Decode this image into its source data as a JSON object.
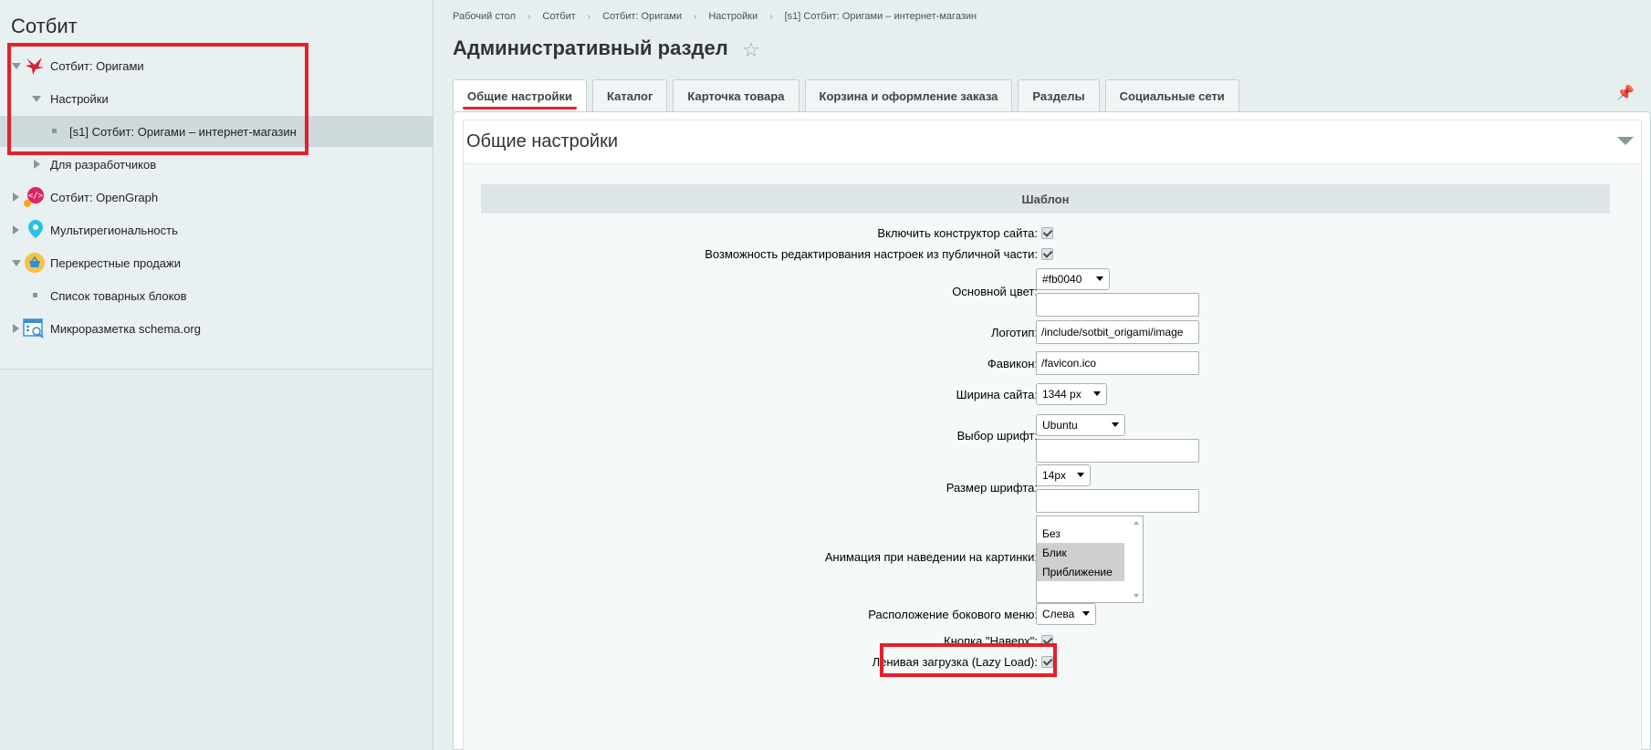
{
  "sidebar": {
    "title": "Сотбит",
    "items": [
      {
        "label": "Сотбит: Оригами",
        "icon": "origami-crane-icon"
      },
      {
        "label": "Настройки"
      },
      {
        "label": "[s1] Сотбит: Оригами – интернет-магазин"
      },
      {
        "label": "Для разработчиков"
      },
      {
        "label": "Сотбит: OpenGraph",
        "icon": "opengraph-icon"
      },
      {
        "label": "Мультирегиональность",
        "icon": "location-pin-icon"
      },
      {
        "label": "Перекрестные продажи",
        "icon": "basket-icon"
      },
      {
        "label": "Список товарных блоков"
      },
      {
        "label": "Микроразметка schema.org",
        "icon": "schema-org-icon"
      }
    ]
  },
  "breadcrumb": [
    "Рабочий стол",
    "Сотбит",
    "Сотбит: Оригами",
    "Настройки",
    "[s1] Сотбит: Оригами – интернет-магазин"
  ],
  "page_title": "Административный раздел",
  "tabs": [
    "Общие настройки",
    "Каталог",
    "Карточка товара",
    "Корзина и оформление заказа",
    "Разделы",
    "Социальные сети"
  ],
  "panel": {
    "title": "Общие настройки",
    "section": "Шаблон",
    "fields": {
      "site_builder": "Включить конструктор сайта:",
      "public_edit": "Возможность редактирования настроек из публичной части:",
      "main_color": "Основной цвет:",
      "main_color_value": "#fb0040",
      "logo": "Логотип:",
      "logo_value": "/include/sotbit_origami/image",
      "favicon": "Фавикон:",
      "favicon_value": "/favicon.ico",
      "site_width": "Ширина сайта:",
      "site_width_value": "1344 px",
      "font_choice": "Выбор шрифт:",
      "font_choice_value": "Ubuntu",
      "font_size": "Размер шрифта:",
      "font_size_value": "14px",
      "hover_animation": "Анимация при наведении на картинки:",
      "hover_animation_options": [
        "Без",
        "Блик",
        "Приближение"
      ],
      "side_menu": "Расположение бокового меню:",
      "side_menu_value": "Слева",
      "up_button": "Кнопка \"Наверх\":",
      "lazy_load": "Ленивая загрузка (Lazy Load):"
    }
  },
  "colors": {
    "highlight_red": "#e5202a"
  }
}
